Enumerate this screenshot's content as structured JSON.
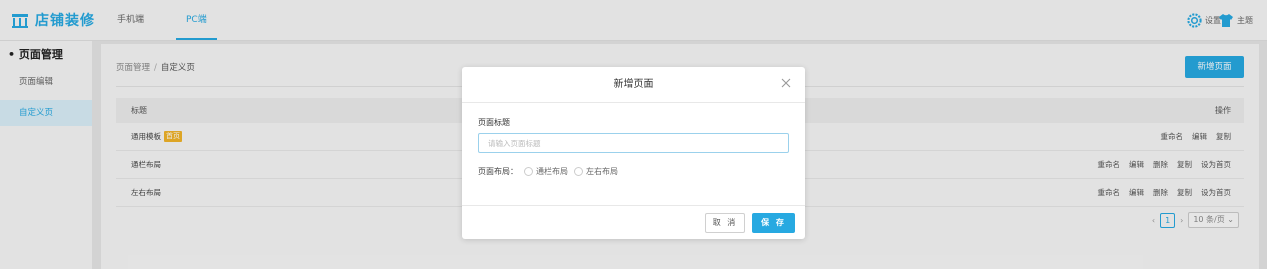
{
  "brand": {
    "title": "店铺装修"
  },
  "top_tabs": [
    {
      "label": "手机端",
      "active": false
    },
    {
      "label": "PC端",
      "active": true
    }
  ],
  "top_tools": {
    "settings_label": "设置",
    "theme_label": "主题"
  },
  "sidebar": {
    "section_title": "• 页面管理",
    "items": [
      {
        "label": "页面编辑",
        "active": false
      },
      {
        "label": "自定义页",
        "active": true
      }
    ]
  },
  "main": {
    "breadcrumb": {
      "parent": "页面管理",
      "separator": "/",
      "current": "自定义页"
    },
    "new_page_button": "新增页面",
    "table": {
      "headers": {
        "title": "标题",
        "actions": "操作"
      },
      "rows": [
        {
          "title": "通用模板",
          "badge": "首页",
          "actions": [
            "重命名",
            "编辑",
            "复制"
          ]
        },
        {
          "title": "通栏布局",
          "badge": "",
          "actions": [
            "重命名",
            "编辑",
            "删除",
            "复制",
            "设为首页"
          ]
        },
        {
          "title": "左右布局",
          "badge": "",
          "actions": [
            "重命名",
            "编辑",
            "删除",
            "复制",
            "设为首页"
          ]
        }
      ]
    },
    "pagination": {
      "prev": "‹",
      "current_page": "1",
      "next": "›",
      "page_size": "10 条/页"
    }
  },
  "modal": {
    "title": "新增页面",
    "page_title_label": "页面标题",
    "page_title_placeholder": "请输入页面标题",
    "page_title_value": "",
    "layout_label": "页面布局：",
    "layout_options": [
      "通栏布局",
      "左右布局"
    ],
    "cancel_label": "取 消",
    "save_label": "保 存"
  },
  "colors": {
    "accent": "#27a9e1",
    "badge": "#f0b42a"
  }
}
